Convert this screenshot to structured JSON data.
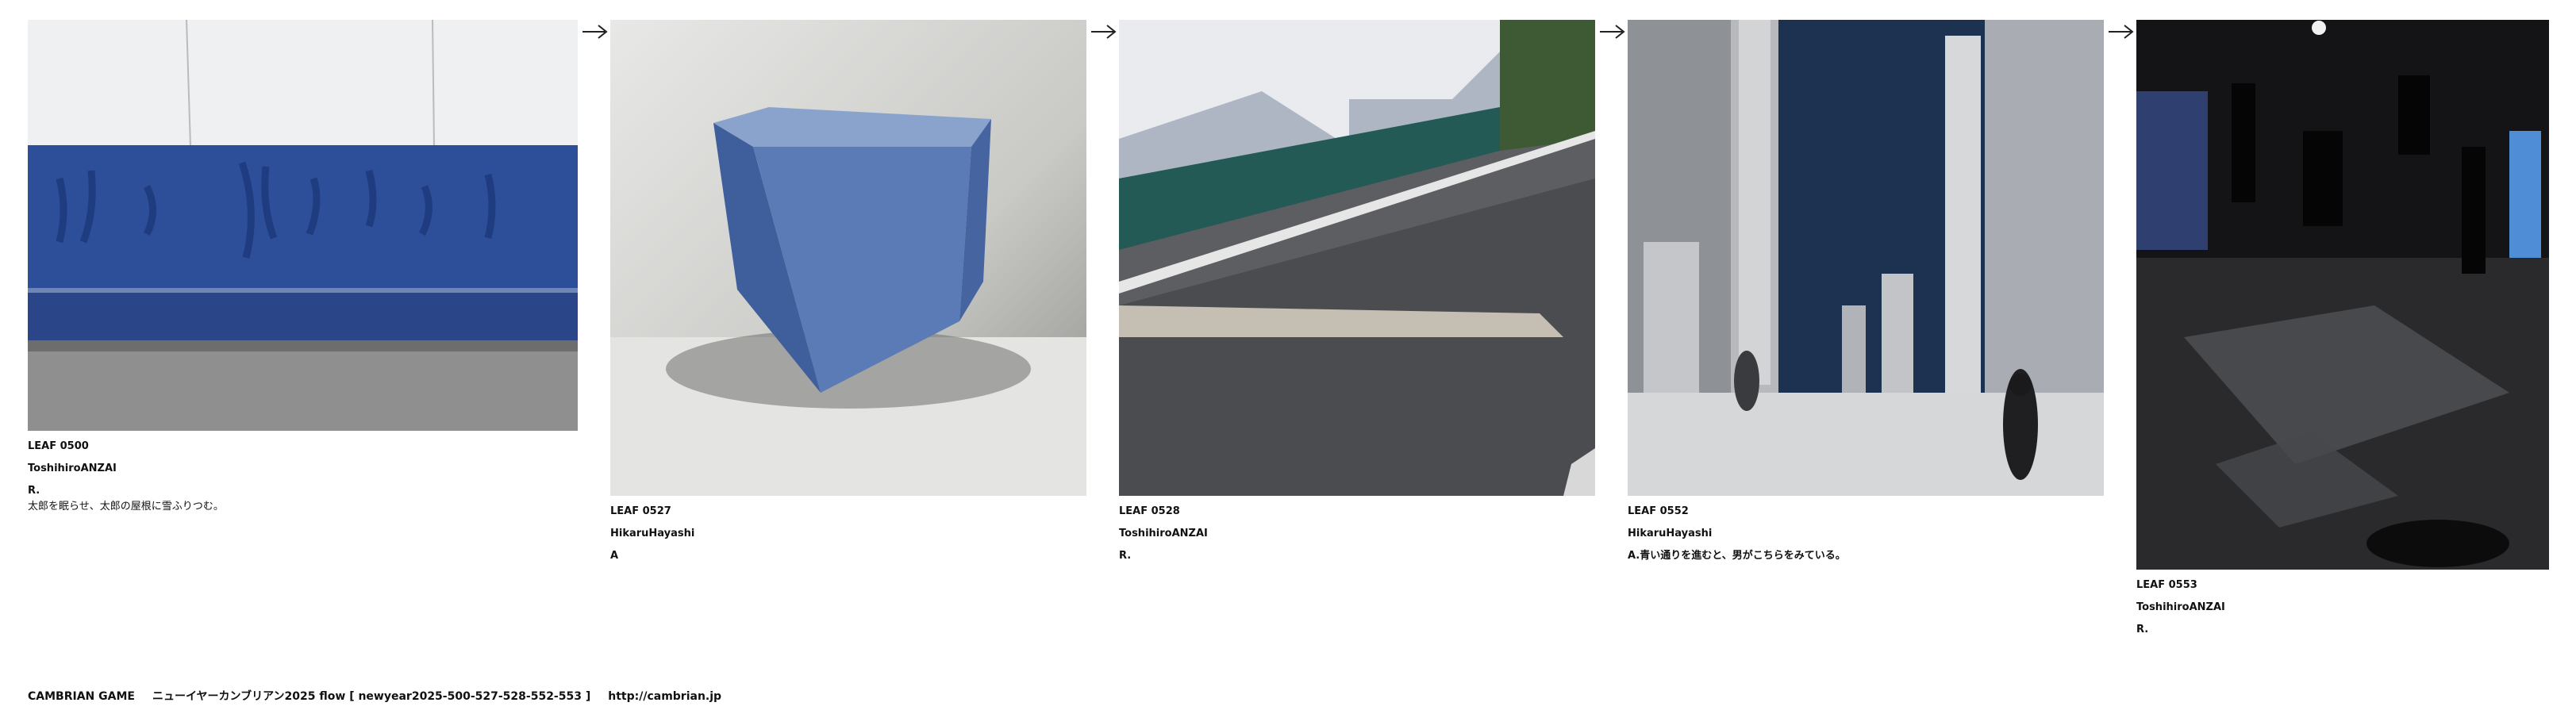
{
  "colors": {
    "background": "#ffffff",
    "text": "#111111",
    "wall_blue": "#2d4f9a",
    "cube_blue": "#4f71ad"
  },
  "leaves": [
    {
      "number": "LEAF 0500",
      "author": "ToshihiroANZAI",
      "text": "R.",
      "note": "太郎を眠らせ、太郎の屋根に雪ふりつむ。",
      "image_name": "blue-painted-wall-photo"
    },
    {
      "number": "LEAF 0527",
      "author": "HikaruHayashi",
      "text": "A",
      "image_name": "blue-glass-cube-photo"
    },
    {
      "number": "LEAF 0528",
      "author": "ToshihiroANZAI",
      "text": "R.",
      "image_name": "street-shadow-photo"
    },
    {
      "number": "LEAF 0552",
      "author": "HikaruHayashi",
      "text": "A.青い通りを進むと、男がこちらをみている。",
      "image_name": "city-towers-collage-photo"
    },
    {
      "number": "LEAF 0553",
      "author": "ToshihiroANZAI",
      "text": "R.",
      "image_name": "dark-exhibition-room-photo"
    }
  ],
  "arrow_icon": "right-arrow-icon",
  "footer": {
    "site": "CAMBRIAN GAME",
    "flow": "ニューイヤーカンブリアン2025  flow [ newyear2025-500-527-528-552-553 ]",
    "url": "http://cambrian.jp"
  }
}
